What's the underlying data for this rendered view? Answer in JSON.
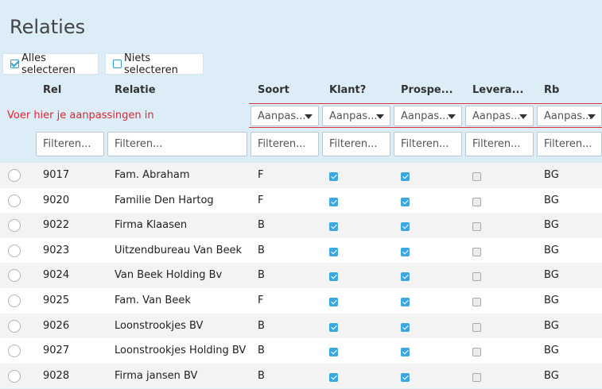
{
  "page": {
    "title": "Relaties"
  },
  "toolbar": {
    "select_all": "Alles selecteren",
    "select_none": "Niets selecteren"
  },
  "columns": [
    "Rel",
    "Relatie",
    "Soort",
    "Klant?",
    "Prospe...",
    "Levera...",
    "Rb"
  ],
  "edit_note": "Voer hier je aanpassingen in",
  "bulk_edit_placeholder": "Aanpas...",
  "filter_placeholder": "Filteren...",
  "rows": [
    {
      "rel": "9017",
      "relatie": "Fam. Abraham",
      "soort": "F",
      "klant": true,
      "prospect": true,
      "leverancier": false,
      "rb": "BG"
    },
    {
      "rel": "9020",
      "relatie": "Familie Den Hartog",
      "soort": "F",
      "klant": true,
      "prospect": true,
      "leverancier": false,
      "rb": "BG"
    },
    {
      "rel": "9022",
      "relatie": "Firma Klaasen",
      "soort": "B",
      "klant": true,
      "prospect": true,
      "leverancier": false,
      "rb": "BG"
    },
    {
      "rel": "9023",
      "relatie": "Uitzendbureau Van Beek",
      "soort": "B",
      "klant": true,
      "prospect": true,
      "leverancier": false,
      "rb": "BG"
    },
    {
      "rel": "9024",
      "relatie": "Van Beek Holding Bv",
      "soort": "B",
      "klant": true,
      "prospect": true,
      "leverancier": false,
      "rb": "BG"
    },
    {
      "rel": "9025",
      "relatie": "Fam. Van Beek",
      "soort": "F",
      "klant": true,
      "prospect": true,
      "leverancier": false,
      "rb": "BG"
    },
    {
      "rel": "9026",
      "relatie": "Loonstrookjes BV",
      "soort": "B",
      "klant": true,
      "prospect": true,
      "leverancier": false,
      "rb": "BG"
    },
    {
      "rel": "9027",
      "relatie": "Loonstrookjes Holding BV",
      "soort": "B",
      "klant": true,
      "prospect": true,
      "leverancier": false,
      "rb": "BG"
    },
    {
      "rel": "9028",
      "relatie": "Firma jansen BV",
      "soort": "B",
      "klant": true,
      "prospect": true,
      "leverancier": false,
      "rb": "BG"
    }
  ],
  "colors": {
    "accent": "#3ba7e0",
    "note_red": "#e0262e",
    "background": "#dcedf8"
  }
}
